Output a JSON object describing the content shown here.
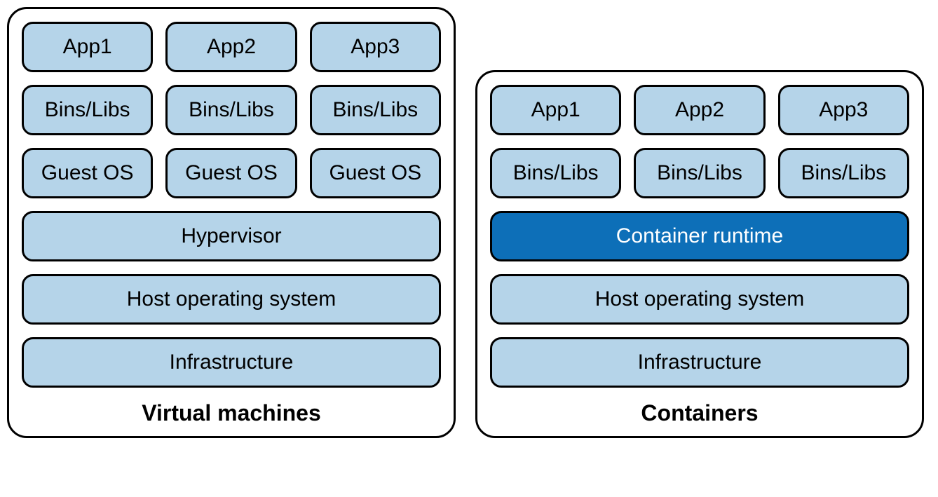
{
  "vm": {
    "title": "Virtual machines",
    "apps": [
      "App1",
      "App2",
      "App3"
    ],
    "bins": [
      "Bins/Libs",
      "Bins/Libs",
      "Bins/Libs"
    ],
    "guests": [
      "Guest OS",
      "Guest OS",
      "Guest OS"
    ],
    "hypervisor": "Hypervisor",
    "host_os": "Host operating system",
    "infra": "Infrastructure"
  },
  "ct": {
    "title": "Containers",
    "apps": [
      "App1",
      "App2",
      "App3"
    ],
    "bins": [
      "Bins/Libs",
      "Bins/Libs",
      "Bins/Libs"
    ],
    "runtime": "Container runtime",
    "host_os": "Host operating system",
    "infra": "Infrastructure"
  }
}
